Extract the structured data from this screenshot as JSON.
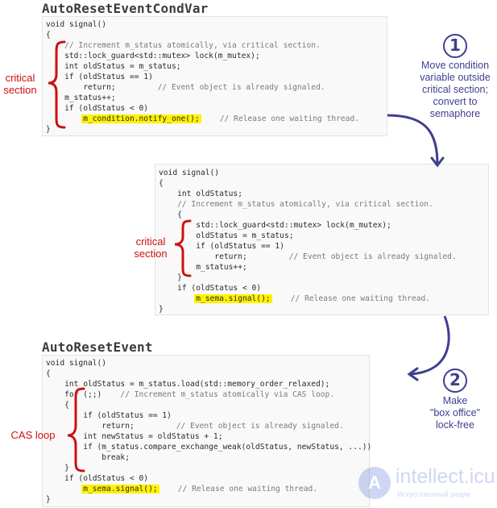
{
  "blocks": [
    {
      "title": "AutoResetEventCondVar",
      "lines": [
        [
          {
            "t": "void signal()"
          }
        ],
        [
          {
            "t": "{"
          }
        ],
        [
          {
            "t": "    "
          },
          {
            "t": "// Increment m_status atomically, via critical section.",
            "c": "cmt"
          }
        ],
        [
          {
            "t": "    std::lock_guard<std::mutex> lock(m_mutex);"
          }
        ],
        [
          {
            "t": "    int oldStatus = m_status;"
          }
        ],
        [
          {
            "t": "    if (oldStatus == 1)"
          }
        ],
        [
          {
            "t": "        return;         "
          },
          {
            "t": "// Event object is already signaled.",
            "c": "cmt"
          }
        ],
        [
          {
            "t": "    m_status++;"
          }
        ],
        [
          {
            "t": "    if (oldStatus < 0)"
          }
        ],
        [
          {
            "t": "        "
          },
          {
            "t": "m_condition.notify_one();",
            "c": "hl"
          },
          {
            "t": "    "
          },
          {
            "t": "// Release one waiting thread.",
            "c": "cmt"
          }
        ],
        [
          {
            "t": "}"
          }
        ]
      ],
      "brace_label": "critical\nsection"
    },
    {
      "title": "",
      "lines": [
        [
          {
            "t": "void signal()"
          }
        ],
        [
          {
            "t": "{"
          }
        ],
        [
          {
            "t": "    int oldStatus;"
          }
        ],
        [
          {
            "t": "    "
          },
          {
            "t": "// Increment m_status atomically, via critical section.",
            "c": "cmt"
          }
        ],
        [
          {
            "t": "    {"
          }
        ],
        [
          {
            "t": "        std::lock_guard<std::mutex> lock(m_mutex);"
          }
        ],
        [
          {
            "t": "        oldStatus = m_status;"
          }
        ],
        [
          {
            "t": "        if (oldStatus == 1)"
          }
        ],
        [
          {
            "t": "            return;         "
          },
          {
            "t": "// Event object is already signaled.",
            "c": "cmt"
          }
        ],
        [
          {
            "t": "        m_status++;"
          }
        ],
        [
          {
            "t": "    }"
          }
        ],
        [
          {
            "t": "    if (oldStatus < 0)"
          }
        ],
        [
          {
            "t": "        "
          },
          {
            "t": "m_sema.signal();",
            "c": "hl"
          },
          {
            "t": "    "
          },
          {
            "t": "// Release one waiting thread.",
            "c": "cmt"
          }
        ],
        [
          {
            "t": "}"
          }
        ]
      ],
      "brace_label": "critical\nsection"
    },
    {
      "title": "AutoResetEvent",
      "lines": [
        [
          {
            "t": "void signal()"
          }
        ],
        [
          {
            "t": "{"
          }
        ],
        [
          {
            "t": "    int oldStatus = m_status.load(std::memory_order_relaxed);"
          }
        ],
        [
          {
            "t": "    for (;;)    "
          },
          {
            "t": "// Increment m_status atomically via CAS loop.",
            "c": "cmt"
          }
        ],
        [
          {
            "t": "    {"
          }
        ],
        [
          {
            "t": "        if (oldStatus == 1)"
          }
        ],
        [
          {
            "t": "            return;         "
          },
          {
            "t": "// Event object is already signaled.",
            "c": "cmt"
          }
        ],
        [
          {
            "t": "        int newStatus = oldStatus + 1;"
          }
        ],
        [
          {
            "t": "        if (m_status.compare_exchange_weak(oldStatus, newStatus, ...))"
          }
        ],
        [
          {
            "t": "            break;"
          }
        ],
        [
          {
            "t": "    }"
          }
        ],
        [
          {
            "t": "    if (oldStatus < 0)"
          }
        ],
        [
          {
            "t": "        "
          },
          {
            "t": "m_sema.signal();",
            "c": "hl"
          },
          {
            "t": "    "
          },
          {
            "t": "// Release one waiting thread.",
            "c": "cmt"
          }
        ],
        [
          {
            "t": "}"
          }
        ]
      ],
      "brace_label": "CAS loop"
    }
  ],
  "steps": [
    {
      "number": "1",
      "text": "Move condition\nvariable outside\ncritical section;\nconvert to\nsemaphore"
    },
    {
      "number": "2",
      "text": "Make\n\"box office\"\nlock-free"
    }
  ],
  "colors": {
    "accent": "#3f3f8f",
    "brace": "#cc1010",
    "highlight": "#fff200",
    "code_bg": "#f9f9f9"
  },
  "watermark": {
    "brand": "intellect.icu",
    "tagline": "Искусственный разум"
  }
}
